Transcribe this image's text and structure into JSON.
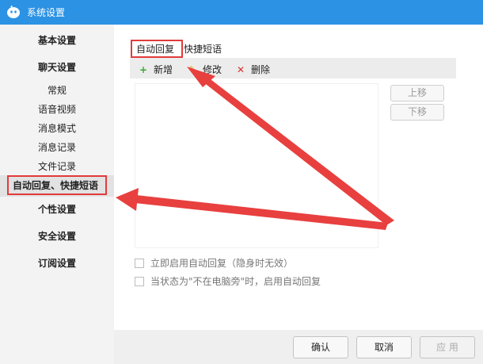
{
  "window": {
    "title": "系统设置"
  },
  "sidebar": {
    "items": [
      {
        "label": "基本设置"
      },
      {
        "label": "聊天设置"
      },
      {
        "label": "常规"
      },
      {
        "label": "语音视频"
      },
      {
        "label": "消息模式"
      },
      {
        "label": "消息记录"
      },
      {
        "label": "文件记录"
      },
      {
        "label": "自动回复、快捷短语"
      },
      {
        "label": "个性设置"
      },
      {
        "label": "安全设置"
      },
      {
        "label": "订阅设置"
      }
    ]
  },
  "tabs": [
    {
      "label": "自动回复"
    },
    {
      "label": "快捷短语"
    }
  ],
  "toolbar": {
    "add": {
      "glyph": "+",
      "label": "新增"
    },
    "edit": {
      "glyph": "✎",
      "label": "修改"
    },
    "delete": {
      "glyph": "✕",
      "label": "删除"
    }
  },
  "side_buttons": {
    "up": "上移",
    "down": "下移"
  },
  "options": {
    "enable_now": "立即启用自动回复（隐身时无效）",
    "when_away": "当状态为\"不在电脑旁\"时，启用自动回复"
  },
  "footer": {
    "ok": "确认",
    "cancel": "取消",
    "apply": "应 用"
  },
  "colors": {
    "titlebar": "#2b92e4",
    "highlight_box": "#e23b3b",
    "arrow": "#e8403f",
    "add_icon": "#3aa835",
    "edit_icon": "#e6a21c",
    "delete_icon": "#d9302e"
  }
}
